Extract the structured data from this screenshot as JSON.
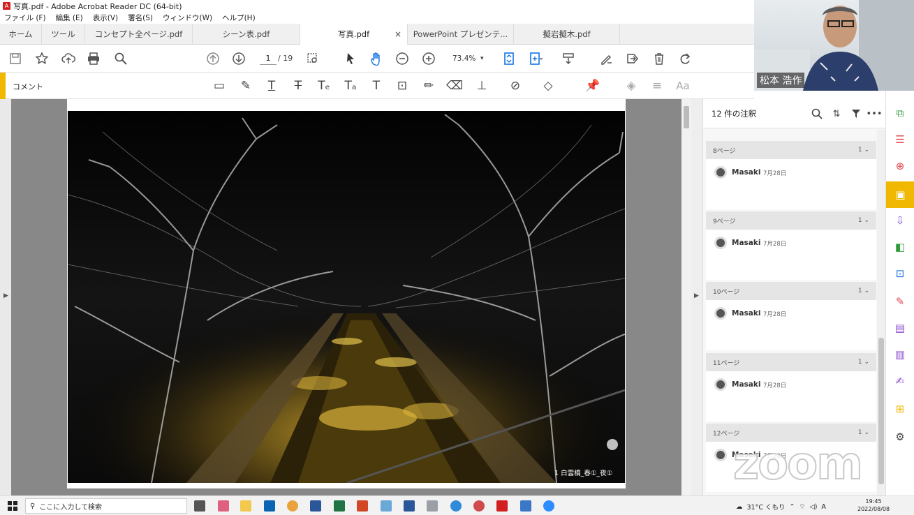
{
  "window": {
    "title": "写真.pdf - Adobe Acrobat Reader DC (64-bit)",
    "app_icon": "acrobat-icon"
  },
  "menu": [
    "ファイル (F)",
    "編集 (E)",
    "表示(V)",
    "署名(S)",
    "ウィンドウ(W)",
    "ヘルプ(H)"
  ],
  "tabs": [
    {
      "label": "ホーム"
    },
    {
      "label": "ツール"
    },
    {
      "label": "コンセプト全ページ.pdf"
    },
    {
      "label": "シーン表.pdf"
    },
    {
      "label": "写真.pdf",
      "active": true,
      "close": "×"
    },
    {
      "label": "PowerPoint プレゼンテ..."
    },
    {
      "label": "擬岩擬木.pdf"
    }
  ],
  "toolbar": {
    "page_current": "1",
    "page_total": "/ 19",
    "zoom": "73.4%",
    "zoom_chevron": "▾"
  },
  "comment_bar": {
    "label": "コメント",
    "font_tool": "Aa"
  },
  "document": {
    "caption": "1 白雲橋_春①_夜①"
  },
  "comments_panel": {
    "title": "12 件の注釈",
    "groups": [
      {
        "page": "8ページ",
        "count": "1",
        "author": "Masaki",
        "date": "7月28日"
      },
      {
        "page": "9ページ",
        "count": "1",
        "author": "Masaki",
        "date": "7月28日"
      },
      {
        "page": "10ページ",
        "count": "1",
        "author": "Masaki",
        "date": "7月28日"
      },
      {
        "page": "11ページ",
        "count": "1",
        "author": "Masaki",
        "date": "7月28日"
      },
      {
        "page": "12ページ",
        "count": "1",
        "author": "Masaki",
        "date": "7月28日"
      }
    ]
  },
  "video": {
    "participant": "松本 浩作",
    "watermark": "zoom"
  },
  "taskbar": {
    "search_placeholder": "ここに入力して検索",
    "weather": "31°C くもり",
    "ime": "A",
    "time": "19:45",
    "date": "2022/08/08"
  },
  "colors": {
    "accent": "#f0b800",
    "rail_icon_blue": "#1473e6",
    "rail_icon_green": "#2d9d3a",
    "rail_icon_red": "#e34850",
    "rail_icon_purple": "#8a4fd1"
  }
}
